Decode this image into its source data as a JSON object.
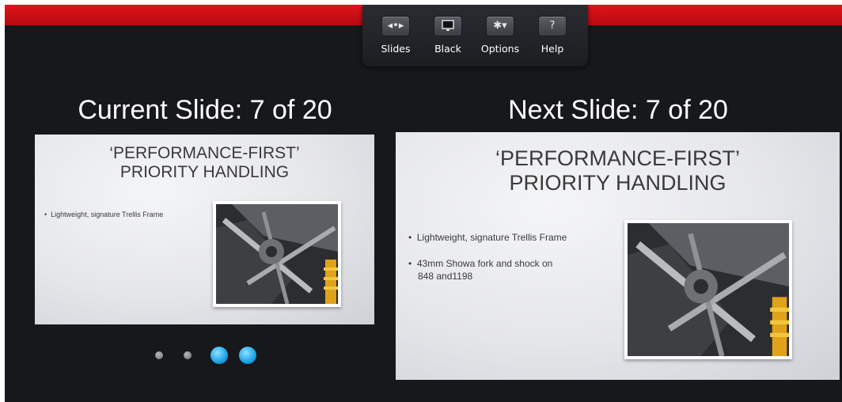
{
  "toolbar": {
    "buttons": [
      {
        "label": "Slides",
        "icon": "arrows-icon",
        "glyph": "◂•▸"
      },
      {
        "label": "Black",
        "icon": "monitor-icon",
        "glyph": ""
      },
      {
        "label": "Options",
        "icon": "gear-icon",
        "glyph": "✱▾"
      },
      {
        "label": "Help",
        "icon": "help-icon",
        "glyph": "?"
      }
    ]
  },
  "current": {
    "heading": "Current Slide: 7 of 20",
    "slide": {
      "title_line1": "‘PERFORMANCE-FIRST’",
      "title_line2": "PRIORITY HANDLING",
      "bullets": [
        "Lightweight, signature Trellis Frame"
      ]
    }
  },
  "next": {
    "heading": "Next Slide: 7 of 20",
    "slide": {
      "title_line1": "‘PERFORMANCE-FIRST’",
      "title_line2": "PRIORITY HANDLING",
      "bullets": [
        "Lightweight, signature Trellis Frame",
        "43mm Showa fork and shock on",
        "848 and1198"
      ]
    }
  },
  "page_indicator": {
    "count": 4,
    "active": [
      3,
      4
    ]
  },
  "colors": {
    "brand_red": "#e2141a",
    "background": "#16181c",
    "dot_active": "#1aa3e8",
    "dot_inactive": "#8a8c90"
  }
}
